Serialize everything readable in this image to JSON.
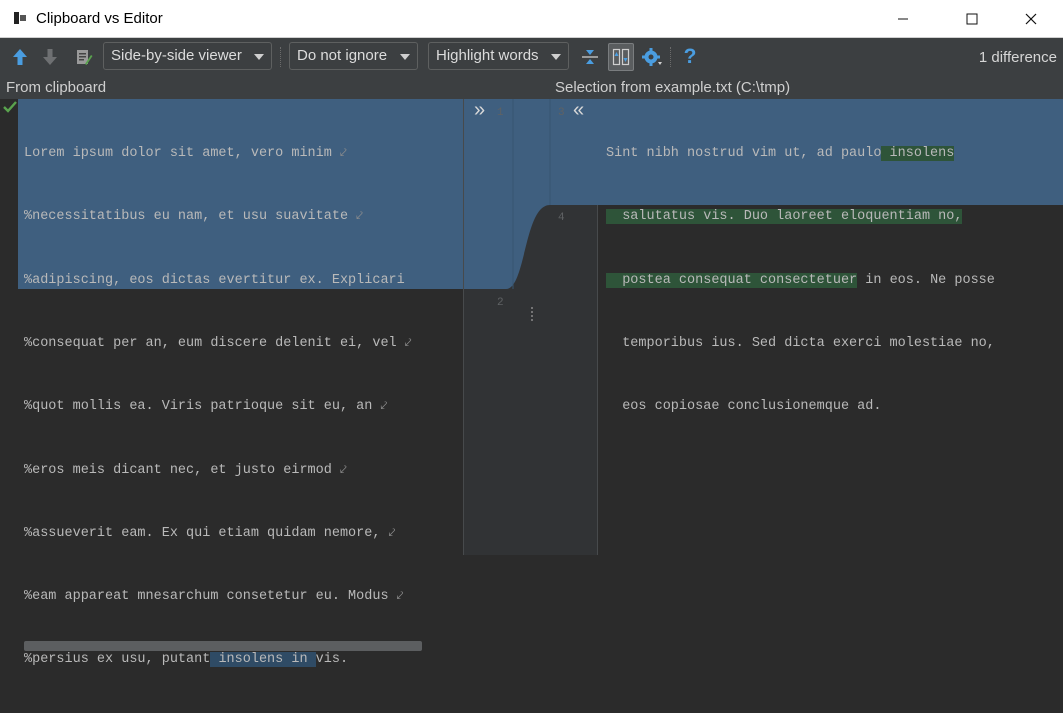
{
  "window": {
    "title": "Clipboard vs Editor"
  },
  "toolbar": {
    "viewer_mode": "Side-by-side viewer",
    "ignore_mode": "Do not ignore",
    "highlight_mode": "Highlight words",
    "difference_count": "1 difference",
    "help_label": "?",
    "icons": [
      "arrow-up-icon",
      "arrow-down-icon",
      "edit-source-icon",
      "collapse-unchanged-icon",
      "sync-scroll-icon",
      "gear-icon",
      "help-icon"
    ]
  },
  "panels": {
    "left_title": "From clipboard",
    "right_title": "Selection from example.txt (C:\\tmp)"
  },
  "left_editor": {
    "lines": [
      "Lorem ipsum dolor sit amet, vero minim",
      "%necessitatibus eu nam, et usu suavitate",
      "%adipiscing, eos dictas evertitur ex. Explicari",
      "%consequat per an, eum discere delenit ei, vel",
      "%quot mollis ea. Viris patrioque sit eu, an",
      "%eros meis dicant nec, et justo eirmod",
      "%assueverit eam. Ex qui etiam quidam nemore,",
      "%eam appareat mnesarchum consetetur eu. Modus"
    ],
    "last_line": {
      "before": "%persius ex usu, putant",
      "middle": " insolens in ",
      "after": "vis."
    },
    "wrap_mark": "⤦"
  },
  "right_editor": {
    "line1": {
      "hl": "Sint nibh nostrud vim ut, ad paulo",
      "green": " insolens"
    },
    "line2": {
      "green": "  salutatus vis. Duo laoreet eloquentiam no,"
    },
    "line3": {
      "green": "  postea consequat consectetuer",
      "mid": " in ",
      "hl": "eos. Ne posse"
    },
    "line4": {
      "hl": "  temporibus ius. Sed dicta exerci",
      "rest": " molestiae no,"
    },
    "line5": {
      "hl": "  eos copiosae conclusionemque ad",
      "rest": "."
    }
  },
  "gutter": {
    "left_line_numbers": [
      "1",
      "2"
    ],
    "right_line_numbers": [
      "3",
      "4"
    ],
    "apply_left_symbol": "»",
    "apply_right_symbol": "«"
  },
  "colors": {
    "changed_block": "#3f5f7f",
    "inserted_words": "#2e5439",
    "toolbar_bg": "#3c3f41",
    "editor_bg": "#2b2b2b"
  }
}
